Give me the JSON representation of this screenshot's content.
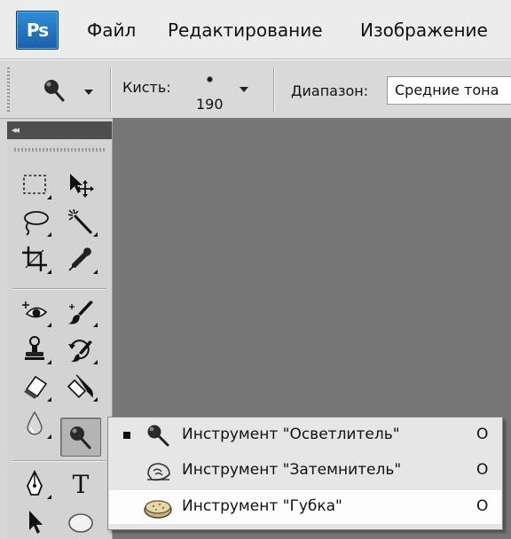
{
  "app": {
    "logo_text": "Ps",
    "menu": [
      "Файл",
      "Редактирование",
      "Изображение"
    ]
  },
  "options": {
    "brush_label": "Кисть:",
    "brush_size": "190",
    "range_label": "Диапазон:",
    "range_value": "Средние тона"
  },
  "toolbox": {
    "collapse_glyph": "◂◂",
    "type_glyph": "T",
    "active_tool": "dodge-tool"
  },
  "flyout": {
    "items": [
      {
        "label": "Инструмент \"Осветлитель\"",
        "shortcut": "O",
        "current": true,
        "icon": "dodge-icon"
      },
      {
        "label": "Инструмент \"Затемнитель\"",
        "shortcut": "O",
        "current": false,
        "icon": "burn-icon"
      },
      {
        "label": "Инструмент \"Губка\"",
        "shortcut": "O",
        "current": false,
        "icon": "sponge-icon"
      }
    ],
    "hovered_index": 2
  },
  "colors": {
    "canvas": "#767676",
    "panel_header": "#4e4e4e",
    "ps_blue": "#1f6fbf"
  }
}
